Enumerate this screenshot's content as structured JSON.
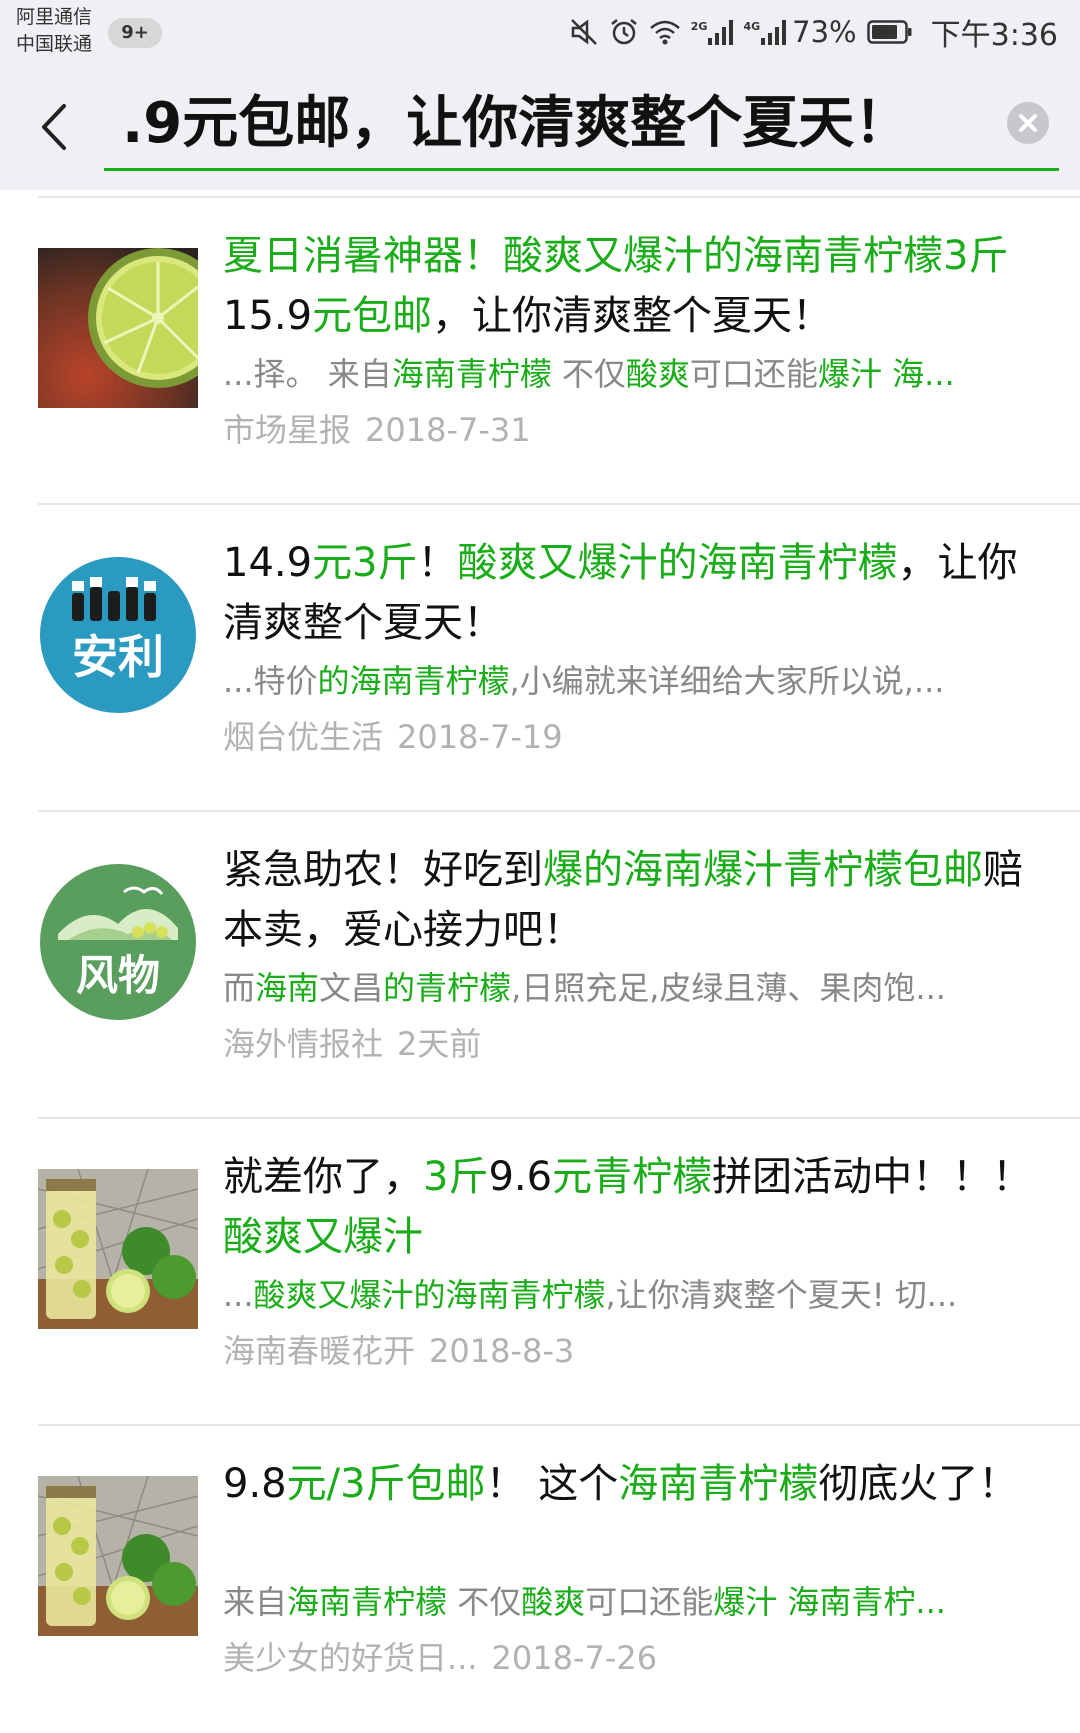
{
  "status_bar": {
    "carrier_1": "阿里通信",
    "carrier_2": "中国联通",
    "notifications": "9+",
    "network_2g": "2G",
    "network_4g": "4G",
    "battery": "73%",
    "time": "下午3:36",
    "icons": [
      "mute-icon",
      "alarm-icon",
      "wifi-icon",
      "signal-icon",
      "battery-icon"
    ]
  },
  "header": {
    "search_query": ".9元包邮，让你清爽整个夏天！"
  },
  "colors": {
    "highlight": "#1aad19",
    "title_text": "#111111",
    "snippet_text": "#888888",
    "meta_text": "#b2b2b2",
    "header_bg": "#efeff4"
  },
  "results": [
    {
      "title_parts": [
        {
          "t": "夏日消暑神器！",
          "hl": true
        },
        {
          "t": "酸爽又爆汁的海南青柠檬",
          "hl": true
        },
        {
          "t": "3斤",
          "hl": true
        },
        {
          "t": "15.9",
          "hl": false
        },
        {
          "t": "元包邮",
          "hl": true
        },
        {
          "t": "，让你清爽整个夏天！",
          "hl": false
        }
      ],
      "snippet_parts": [
        {
          "t": "...择。 来自",
          "hl": false
        },
        {
          "t": "海南青柠檬",
          "hl": true
        },
        {
          "t": " 不仅",
          "hl": false
        },
        {
          "t": "酸爽",
          "hl": true
        },
        {
          "t": "可口还能",
          "hl": false
        },
        {
          "t": "爆汁",
          "hl": true
        },
        {
          "t": " 海...",
          "hl": true
        }
      ],
      "source": "市场星报",
      "date": "2018-7-31",
      "thumb": "lime-slice-photo"
    },
    {
      "title_parts": [
        {
          "t": "14.9",
          "hl": false
        },
        {
          "t": "元3斤",
          "hl": true
        },
        {
          "t": "！",
          "hl": false
        },
        {
          "t": "酸爽又爆汁的海南青柠檬",
          "hl": true
        },
        {
          "t": "，让你清爽整个夏天！",
          "hl": false
        }
      ],
      "snippet_parts": [
        {
          "t": "...特价",
          "hl": false
        },
        {
          "t": "的海南青柠檬",
          "hl": true
        },
        {
          "t": ",小编就来详细给大家所以说,...",
          "hl": false
        }
      ],
      "source": "烟台优生活",
      "date": "2018-7-19",
      "thumb_text": "安利"
    },
    {
      "title_parts": [
        {
          "t": "紧急助农！好吃到",
          "hl": false
        },
        {
          "t": "爆的海南爆汁青柠檬包邮",
          "hl": true
        },
        {
          "t": "赔本卖，爱心接力吧！",
          "hl": false
        }
      ],
      "snippet_parts": [
        {
          "t": "而",
          "hl": false
        },
        {
          "t": "海南",
          "hl": true
        },
        {
          "t": "文昌",
          "hl": false
        },
        {
          "t": "的青柠檬",
          "hl": true
        },
        {
          "t": ",日照充足,皮绿且薄、果肉饱...",
          "hl": false
        }
      ],
      "source": "海外情报社",
      "date": "2天前",
      "thumb_text": "风物"
    },
    {
      "title_parts": [
        {
          "t": "就差你了，",
          "hl": false
        },
        {
          "t": "3斤",
          "hl": true
        },
        {
          "t": "9.6",
          "hl": false
        },
        {
          "t": "元青柠檬",
          "hl": true
        },
        {
          "t": "拼团活动中！！！ ",
          "hl": false
        },
        {
          "t": "酸爽又爆汁",
          "hl": true
        }
      ],
      "snippet_parts": [
        {
          "t": "...",
          "hl": false
        },
        {
          "t": "酸爽又爆汁的海南青柠檬",
          "hl": true
        },
        {
          "t": ",让你清爽整个夏天! 切...",
          "hl": false
        }
      ],
      "source": "海南春暖花开",
      "date": "2018-8-3",
      "thumb": "lime-jar-photo"
    },
    {
      "title_parts": [
        {
          "t": "9.8",
          "hl": false
        },
        {
          "t": "元/3斤包邮",
          "hl": true
        },
        {
          "t": "！ 这个",
          "hl": false
        },
        {
          "t": "海南青柠檬",
          "hl": true
        },
        {
          "t": "彻底火了！",
          "hl": false
        }
      ],
      "snippet_parts": [
        {
          "t": "来自",
          "hl": false
        },
        {
          "t": "海南青柠檬",
          "hl": true
        },
        {
          "t": " 不仅",
          "hl": false
        },
        {
          "t": "酸爽",
          "hl": true
        },
        {
          "t": "可口还能",
          "hl": false
        },
        {
          "t": "爆汁 海南青柠...",
          "hl": true
        }
      ],
      "source": "美少女的好货日...",
      "date": "2018-7-26",
      "thumb": "lime-jar-photo"
    }
  ]
}
